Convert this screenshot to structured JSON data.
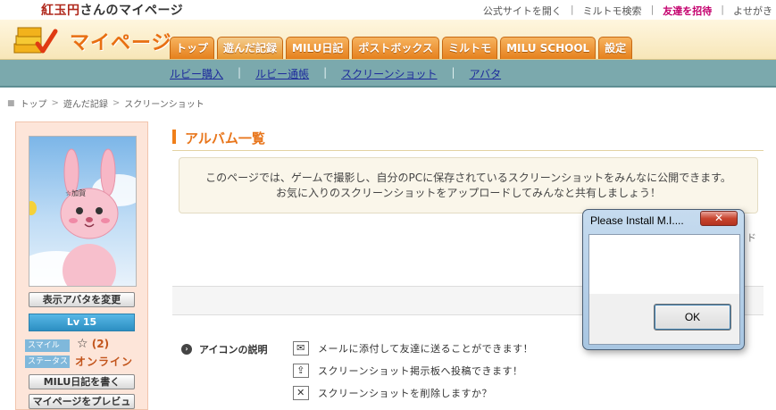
{
  "top": {
    "user_name": "紅玉円",
    "user_suffix": "さんのマイページ",
    "links": [
      "公式サイトを開く",
      "ミルトモ検索",
      "友達を招待",
      "よせがき"
    ]
  },
  "header": {
    "logo_text": "マイページ",
    "tabs": [
      "トップ",
      "遊んだ記録",
      "MILU日記",
      "ポストボックス",
      "ミルトモ",
      "MILU SCHOOL",
      "設定"
    ],
    "active_tab": "遊んだ記録"
  },
  "subnav": [
    "ルビー購入",
    "ルビー通帳",
    "スクリーンショット",
    "アバタ"
  ],
  "breadcrumb": [
    "トップ",
    "遊んだ記録",
    "スクリーンショット"
  ],
  "sidebar": {
    "avatar_caption": "☆加賀",
    "change_avatar_button": "表示アバタを変更",
    "level": "Lv 15",
    "smile_label": "スマイル",
    "smile_value": "(2)",
    "status_label": "ステータス",
    "status_value": "オンライン",
    "write_diary_button": "MILU日記を書く",
    "preview_button": "マイページをプレビュー"
  },
  "main": {
    "section_title": "アルバム一覧",
    "notice_line1": "このページでは、ゲームで撮影し、自分のPCに保存されているスクリーンショットをみんなに公開できます。",
    "notice_line2": "お気に入りのスクリーンショットをアップロードしてみんなと共有しましょう！",
    "edge_text": "ド",
    "icon_help_title": "アイコンの説明",
    "help_items": [
      {
        "icon": "mail-icon",
        "text": "メールに添付して友達に送ることができます！"
      },
      {
        "icon": "upload-icon",
        "text": "スクリーンショット掲示板へ投稿できます！"
      },
      {
        "icon": "delete-icon",
        "text": "スクリーンショットを削除しますか？"
      }
    ]
  },
  "dialog": {
    "title": "Please Install M.I....",
    "close": "✕",
    "ok": "OK"
  },
  "colors": {
    "accent_orange": "#e8761c",
    "subnav_bg": "#7ba9ad",
    "sidebar_bg": "#fde5d9",
    "invite_link": "#c4006e"
  }
}
